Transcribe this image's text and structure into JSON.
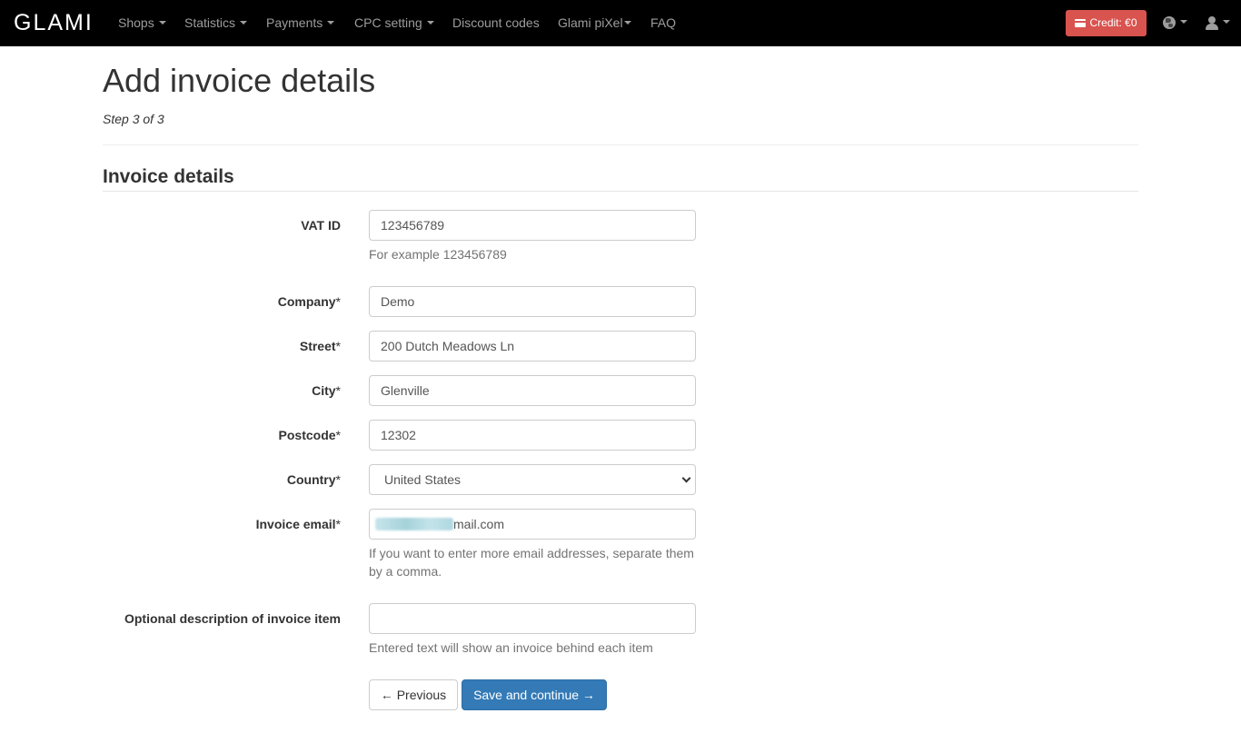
{
  "navbar": {
    "logo": "GLAMI",
    "items": [
      {
        "label": "Shops",
        "dropdown": true
      },
      {
        "label": "Statistics",
        "dropdown": true
      },
      {
        "label": "Payments",
        "dropdown": true
      },
      {
        "label": "CPC setting",
        "dropdown": true
      },
      {
        "label": "Discount codes",
        "dropdown": false
      },
      {
        "label": "Glami piXel",
        "dropdown": true
      },
      {
        "label": "FAQ",
        "dropdown": false
      }
    ],
    "credit_label": "Credit: €0",
    "credit_icon": "credit-card-icon",
    "language_icon": "globe-icon",
    "user_icon": "user-icon"
  },
  "page": {
    "title": "Add invoice details",
    "step": "Step 3 of 3",
    "section_title": "Invoice details"
  },
  "form": {
    "vat_id": {
      "label": "VAT ID",
      "value": "123456789",
      "help": "For example 123456789"
    },
    "company": {
      "label": "Company",
      "required": "*",
      "value": "Demo"
    },
    "street": {
      "label": "Street",
      "required": "*",
      "value": "200 Dutch Meadows Ln"
    },
    "city": {
      "label": "City",
      "required": "*",
      "value": "Glenville"
    },
    "postcode": {
      "label": "Postcode",
      "required": "*",
      "value": "12302"
    },
    "country": {
      "label": "Country",
      "required": "*",
      "value": "United States"
    },
    "invoice_email": {
      "label": "Invoice email",
      "required": "*",
      "value_visible_suffix": "mail.com",
      "help": "If you want to enter more email addresses, separate them by a comma."
    },
    "description": {
      "label": "Optional description of invoice item",
      "value": "",
      "help": "Entered text will show an invoice behind each item"
    }
  },
  "buttons": {
    "previous": "← Previous",
    "save": "Save and continue →"
  },
  "colors": {
    "navbar_bg": "#000000",
    "credit_bg": "#d9534f",
    "primary": "#337ab7"
  }
}
